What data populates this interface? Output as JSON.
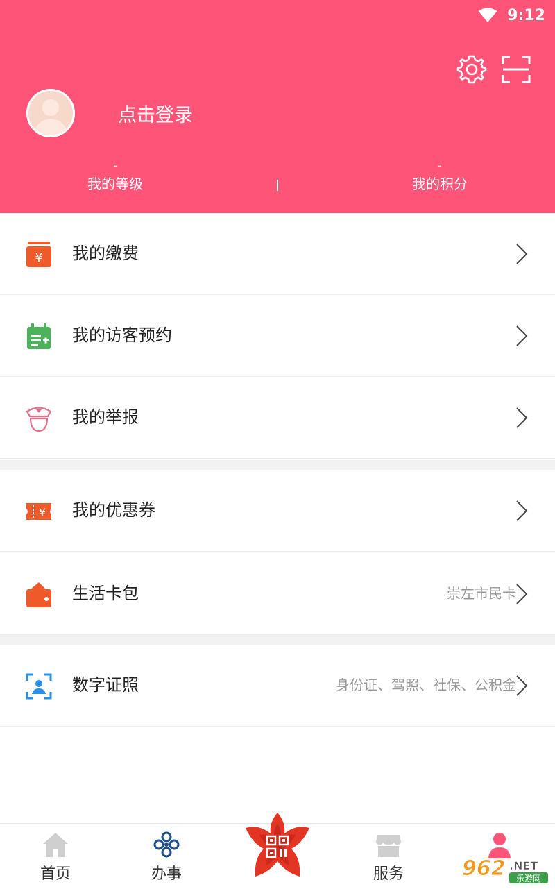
{
  "status_bar": {
    "time": "9:12"
  },
  "header": {
    "login_label": "点击登录",
    "stats": [
      {
        "value": "-",
        "label": "我的等级"
      },
      {
        "value": "-",
        "label": "我的积分"
      }
    ]
  },
  "menu": [
    {
      "label": "我的缴费",
      "hint": "",
      "icon": "payment-icon",
      "color": "#ef5a2a"
    },
    {
      "label": "我的访客预约",
      "hint": "",
      "icon": "calendar-icon",
      "color": "#4cb35c"
    },
    {
      "label": "我的举报",
      "hint": "",
      "icon": "police-icon",
      "color": "#e36f8b"
    },
    {
      "label": "我的优惠券",
      "hint": "",
      "icon": "coupon-icon",
      "color": "#ef5a2a"
    },
    {
      "label": "生活卡包",
      "hint": "崇左市民卡",
      "icon": "wallet-icon",
      "color": "#ef5a2a"
    },
    {
      "label": "数字证照",
      "hint": "身份证、驾照、社保、公积金",
      "icon": "id-card-icon",
      "color": "#2a8fe6"
    }
  ],
  "tabs": [
    {
      "label": "首页",
      "icon": "home-icon"
    },
    {
      "label": "办事",
      "icon": "affairs-icon"
    },
    {
      "label": "",
      "icon": "qr-flower-icon"
    },
    {
      "label": "服务",
      "icon": "service-icon"
    },
    {
      "label": "",
      "icon": "profile-icon"
    }
  ],
  "watermark": "962.NET 乐游网",
  "colors": {
    "header": "#fd5478",
    "accent": "#ef5a2a"
  }
}
